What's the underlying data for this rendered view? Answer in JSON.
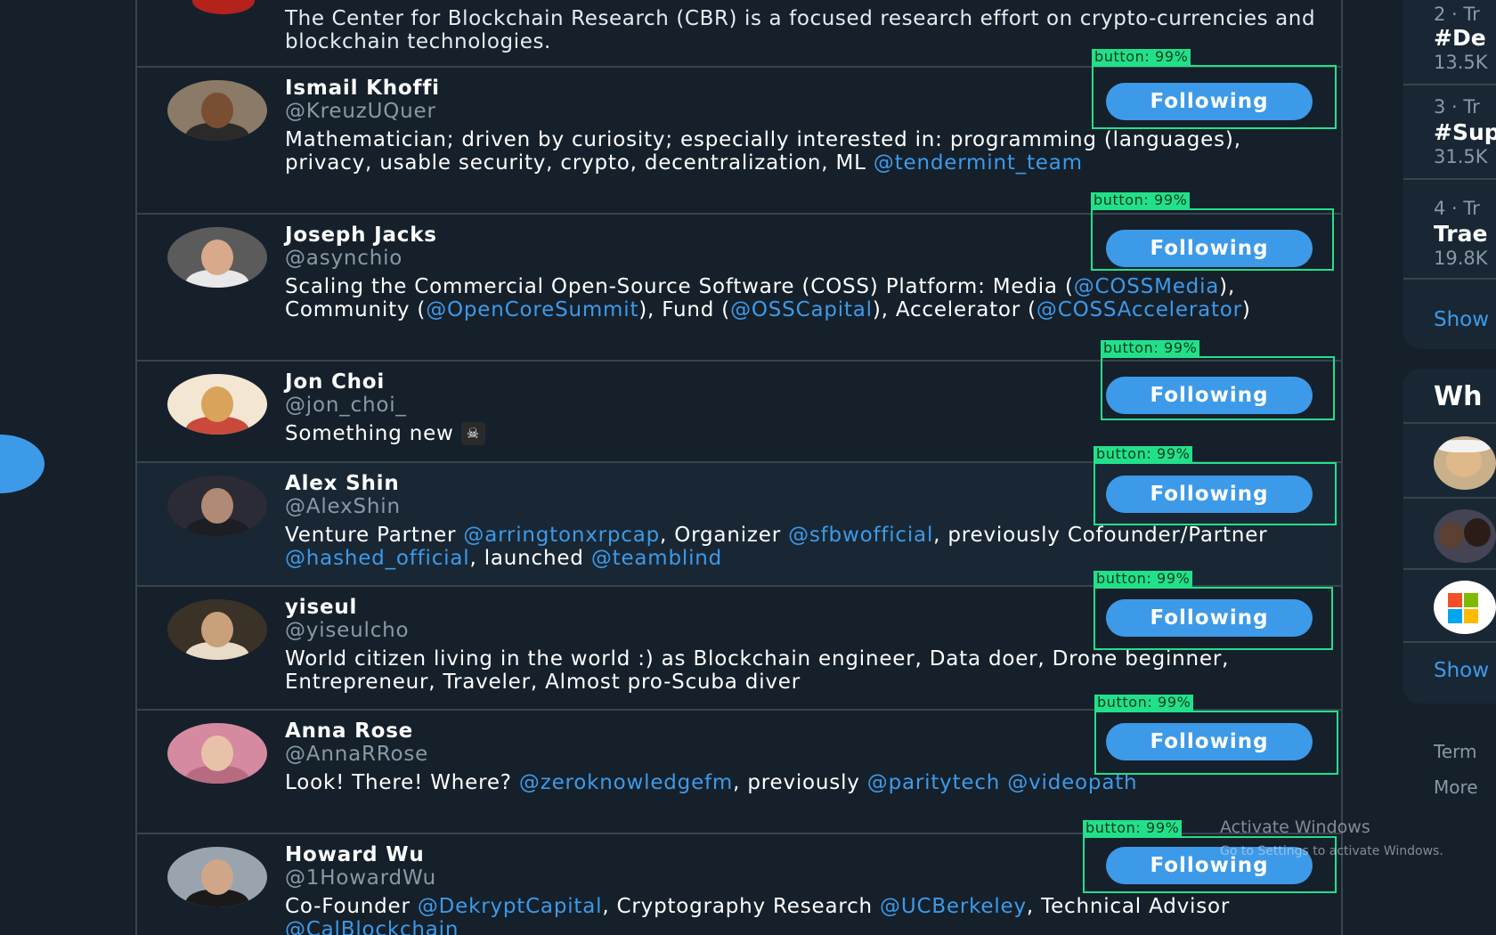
{
  "feed": {
    "top_bio": "The Center for Blockchain Research (CBR) is a focused research effort on crypto-currencies and blockchain technologies.",
    "follow_label": "Following",
    "detection_label": "button: 99%",
    "users": [
      {
        "name": "Ismail Khoffi",
        "handle": "@KreuzUQuer",
        "bio_parts": [
          {
            "t": "Mathematician; driven by curiosity; especially interested in: programming (languages), privacy, usable security, crypto, decentralization, ML "
          },
          {
            "t": "@tendermint_team",
            "m": true
          }
        ]
      },
      {
        "name": "Joseph Jacks",
        "handle": "@asynchio",
        "bio_parts": [
          {
            "t": "Scaling the Commercial Open-Source Software (COSS) Platform: Media ("
          },
          {
            "t": "@COSSMedia",
            "m": true
          },
          {
            "t": "), Community ("
          },
          {
            "t": "@OpenCoreSummit",
            "m": true
          },
          {
            "t": "), Fund ("
          },
          {
            "t": "@OSSCapital",
            "m": true
          },
          {
            "t": "), Accelerator ("
          },
          {
            "t": "@COSSAccelerator",
            "m": true
          },
          {
            "t": ")"
          }
        ]
      },
      {
        "name": "Jon Choi",
        "handle": "@jon_choi_",
        "bio_parts": [
          {
            "t": "Something new "
          }
        ],
        "emoji": "☠"
      },
      {
        "name": "Alex Shin",
        "handle": "@AlexShin",
        "bio_parts": [
          {
            "t": "Venture Partner "
          },
          {
            "t": "@arringtonxrpcap",
            "m": true
          },
          {
            "t": ", Organizer "
          },
          {
            "t": "@sfbwofficial",
            "m": true
          },
          {
            "t": ", previously Cofounder/Partner "
          },
          {
            "t": "@hashed_official",
            "m": true
          },
          {
            "t": ", launched "
          },
          {
            "t": "@teamblind",
            "m": true
          }
        ]
      },
      {
        "name": "yiseul",
        "handle": "@yiseulcho",
        "bio_parts": [
          {
            "t": "World citizen living in the world :) as Blockchain engineer, Data doer, Drone beginner, Entrepreneur, Traveler, Almost pro-Scuba diver"
          }
        ]
      },
      {
        "name": "Anna Rose",
        "handle": "@AnnaRRose",
        "bio_parts": [
          {
            "t": "Look! There! Where? "
          },
          {
            "t": "@zeroknowledgefm",
            "m": true
          },
          {
            "t": ", previously "
          },
          {
            "t": "@paritytech",
            "m": true
          },
          {
            "t": " "
          },
          {
            "t": "@videopath",
            "m": true
          }
        ]
      },
      {
        "name": "Howard Wu",
        "handle": "@1HowardWu",
        "bio_parts": [
          {
            "t": "Co-Founder "
          },
          {
            "t": "@DekryptCapital",
            "m": true
          },
          {
            "t": ", Cryptography Research "
          },
          {
            "t": "@UCBerkeley",
            "m": true
          },
          {
            "t": ", Technical Advisor "
          },
          {
            "t": "@CalBlockchain",
            "m": true
          }
        ]
      }
    ]
  },
  "sidebar": {
    "trends": [
      {
        "meta": "2 · Tr",
        "tag": "#De",
        "count": "13.5K"
      },
      {
        "meta": "3 · Tr",
        "tag": "#Sup",
        "count": "31.5K"
      },
      {
        "meta": "4 · Tr",
        "tag": "Trae",
        "count": "19.8K"
      }
    ],
    "show_more_1": "Show",
    "who_title": "Wh",
    "show_more_2": "Show",
    "footer_terms": "Term",
    "footer_more": "More"
  },
  "watermark": {
    "line1": "Activate Windows",
    "line2": "Go to Settings to activate Windows."
  },
  "colors": {
    "accent": "#3d9ae8",
    "background": "#15202b",
    "detection": "#22e08a"
  }
}
